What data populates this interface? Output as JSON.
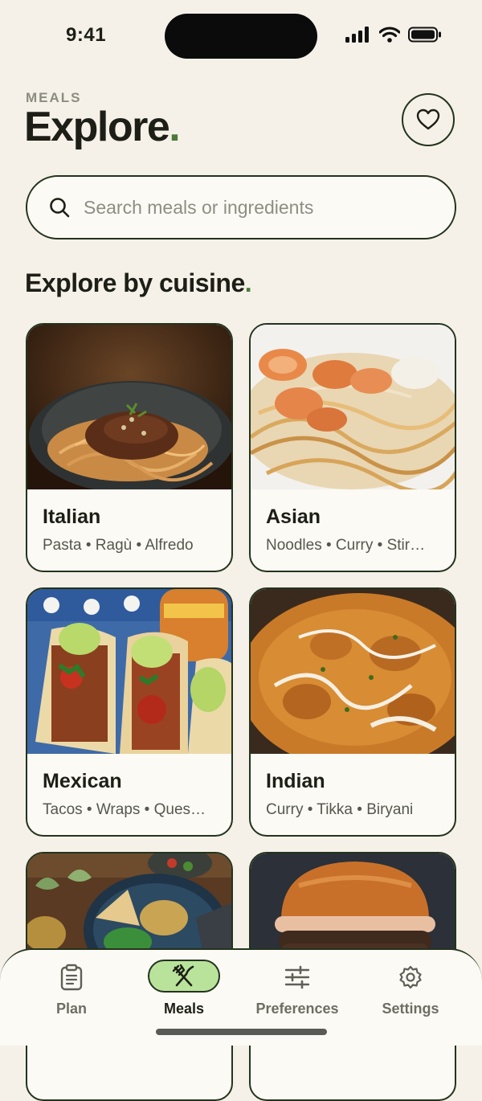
{
  "status": {
    "time": "9:41"
  },
  "header": {
    "section": "MEALS",
    "title": "Explore",
    "title_dot": "."
  },
  "search": {
    "placeholder": "Search meals or ingredients"
  },
  "cuisines_title": "Explore by cuisine",
  "cuisines_title_dot": ".",
  "cuisines": [
    {
      "name": "Italian",
      "tags": "Pasta • Ragù • Alfredo",
      "image": "pasta-bolognese"
    },
    {
      "name": "Asian",
      "tags": "Noodles • Curry • Stir…",
      "image": "pad-thai-shrimp"
    },
    {
      "name": "Mexican",
      "tags": "Tacos • Wraps • Ques…",
      "image": "tacos"
    },
    {
      "name": "Indian",
      "tags": "Curry • Tikka • Biryani",
      "image": "butter-chicken"
    },
    {
      "name": "",
      "tags": "",
      "image": "chickpea-bowl"
    },
    {
      "name": "",
      "tags": "",
      "image": "burger"
    }
  ],
  "tabs": [
    {
      "label": "Plan",
      "icon": "clipboard-icon",
      "active": false
    },
    {
      "label": "Meals",
      "icon": "fork-knife-icon",
      "active": true
    },
    {
      "label": "Preferences",
      "icon": "sliders-icon",
      "active": false
    },
    {
      "label": "Settings",
      "icon": "gear-icon",
      "active": false
    }
  ],
  "colors": {
    "background": "#f5f1e8",
    "accent": "#b9e39b",
    "outline": "#23331d",
    "dot": "#4a7a3a"
  }
}
